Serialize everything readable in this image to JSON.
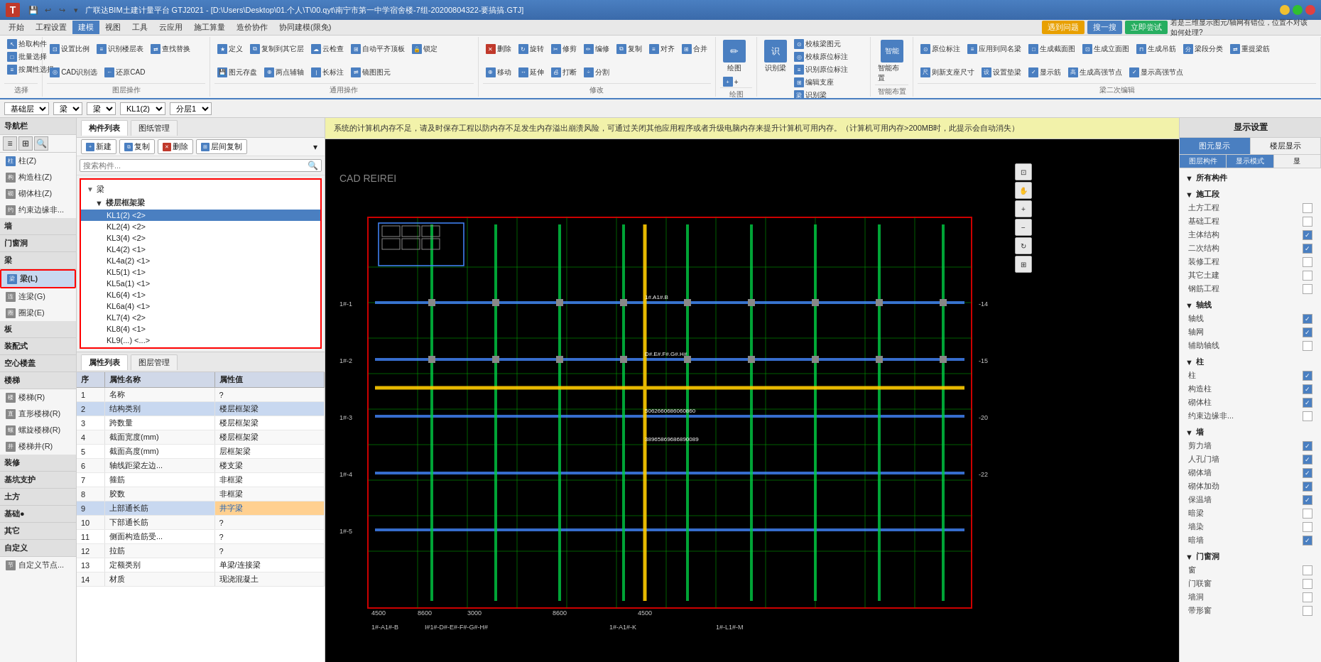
{
  "app": {
    "title": "广联达BIM土建计量平台 GTJ2021 - [D:\\Users\\Desktop\\01.个人\\T\\00.qyt\\南宁市第一中学宿舍楼-7组-20200804322-要搞搞.GTJ]",
    "icon": "T"
  },
  "menu_bar": {
    "items": [
      "开始",
      "工程设置",
      "建模",
      "视图",
      "工具",
      "云应用",
      "施工算量",
      "造价协作",
      "协同建模(限免)"
    ]
  },
  "ribbon": {
    "active_tab": "建模",
    "groups": [
      {
        "label": "选择",
        "buttons": [
          {
            "icon": "↖",
            "label": "拾取构件",
            "color": "#4a7fc1"
          },
          {
            "icon": "□",
            "label": "批量选择",
            "color": "#4a7fc1"
          },
          {
            "icon": "◎",
            "label": "按属性选择",
            "color": "#4a7fc1"
          }
        ]
      },
      {
        "label": "图层操作",
        "buttons": [
          {
            "icon": "✓",
            "label": "设置比例"
          },
          {
            "icon": "★",
            "label": "识别楼层表"
          },
          {
            "icon": "⇄",
            "label": "查找替换"
          },
          {
            "icon": "◎",
            "label": "CAD识别选"
          },
          {
            "icon": "←",
            "label": "还原CAD"
          }
        ]
      },
      {
        "label": "通用操作",
        "buttons": []
      },
      {
        "label": "修改",
        "buttons": []
      },
      {
        "label": "绘图",
        "buttons": []
      },
      {
        "label": "识梁",
        "buttons": []
      },
      {
        "label": "智能布置",
        "buttons": []
      },
      {
        "label": "梁二次编辑",
        "buttons": []
      }
    ]
  },
  "layer_bar": {
    "items": [
      "基础层",
      "梁",
      "梁",
      "KL1(2)",
      "分层1"
    ]
  },
  "nav": {
    "title": "导航栏",
    "sections": [
      {
        "label": "",
        "items": [
          {
            "label": "柱(Z)",
            "icon": "柱",
            "selected": false
          },
          {
            "label": "构造柱(Z)",
            "icon": "构",
            "selected": false
          },
          {
            "label": "砌体柱(Z)",
            "icon": "砌",
            "selected": false
          },
          {
            "label": "约束边缘非...",
            "icon": "约",
            "selected": false
          }
        ]
      },
      {
        "label": "墙",
        "items": []
      },
      {
        "label": "门窗洞",
        "items": []
      },
      {
        "label": "梁",
        "items": [
          {
            "label": "梁(L)",
            "icon": "梁",
            "selected": true
          },
          {
            "label": "连梁(G)",
            "icon": "连",
            "selected": false
          },
          {
            "label": "圈梁(E)",
            "icon": "圈",
            "selected": false
          }
        ]
      },
      {
        "label": "板",
        "items": []
      },
      {
        "label": "装配式",
        "items": []
      },
      {
        "label": "空心楼盖",
        "items": []
      },
      {
        "label": "楼梯",
        "items": [
          {
            "label": "楼梯(R)",
            "icon": "楼",
            "selected": false
          },
          {
            "label": "直形楼梯(R)",
            "icon": "直",
            "selected": false
          },
          {
            "label": "螺旋楼梯(R)",
            "icon": "螺",
            "selected": false
          },
          {
            "label": "楼梯井(R)",
            "icon": "井",
            "selected": false
          }
        ]
      },
      {
        "label": "装修",
        "items": []
      },
      {
        "label": "基坑支护",
        "items": []
      },
      {
        "label": "土方",
        "items": []
      },
      {
        "label": "基础",
        "items": []
      },
      {
        "label": "其它",
        "items": []
      },
      {
        "label": "自定义",
        "items": [
          {
            "label": "自定义节点...",
            "icon": "节",
            "selected": false
          }
        ]
      }
    ]
  },
  "component_panel": {
    "tabs": [
      "构件列表",
      "图纸管理"
    ],
    "active_tab": "构件列表",
    "toolbar": {
      "buttons": [
        "新建",
        "复制",
        "删除",
        "层间复制"
      ]
    },
    "search_placeholder": "搜索构件...",
    "tree": {
      "root": "梁",
      "groups": [
        {
          "label": "楼层框架梁",
          "items": [
            {
              "label": "KL1(2) <2>",
              "selected": true
            },
            {
              "label": "KL2(4) <2>"
            },
            {
              "label": "KL3(4) <2>"
            },
            {
              "label": "KL4(2) <1>"
            },
            {
              "label": "KL4a(2) <1>"
            },
            {
              "label": "KL5(1) <1>"
            },
            {
              "label": "KL5a(1) <1>"
            },
            {
              "label": "KL6(4) <1>"
            },
            {
              "label": "KL6a(4) <1>"
            },
            {
              "label": "KL7(4) <2>"
            },
            {
              "label": "KL8(4) <1>"
            },
            {
              "label": "KL9(...) <...>"
            }
          ]
        }
      ]
    }
  },
  "property_panel": {
    "tabs": [
      "属性列表",
      "图层管理"
    ],
    "active_tab": "属性列表",
    "headers": [
      "序",
      "属性名称",
      "属性值"
    ],
    "rows": [
      {
        "num": "1",
        "name": "名称",
        "value": "?",
        "highlight": false
      },
      {
        "num": "2",
        "name": "结构类别",
        "value": "楼层框架梁",
        "highlight": true
      },
      {
        "num": "3",
        "name": "跨数量",
        "value": "楼层框架梁",
        "highlight": false
      },
      {
        "num": "4",
        "name": "截面宽度(mm)",
        "value": "楼层框架梁",
        "highlight": false
      },
      {
        "num": "5",
        "name": "截面高度(mm)",
        "value": "层框架梁",
        "highlight": false
      },
      {
        "num": "6",
        "name": "轴线距梁左边...",
        "value": "楼支梁",
        "highlight": false
      },
      {
        "num": "7",
        "name": "箍筋",
        "value": "非框梁",
        "highlight": false
      },
      {
        "num": "8",
        "name": "胶数",
        "value": "非框梁",
        "highlight": false
      },
      {
        "num": "9",
        "name": "上部通长筋",
        "value": "井字梁",
        "highlight": true,
        "value_color": "blue"
      },
      {
        "num": "10",
        "name": "下部通长筋",
        "value": "?",
        "highlight": false
      },
      {
        "num": "11",
        "name": "侧面构造筋受...",
        "value": "?",
        "highlight": false
      },
      {
        "num": "12",
        "name": "拉筋",
        "value": "?",
        "highlight": false
      },
      {
        "num": "13",
        "name": "定额类别",
        "value": "单梁/连接梁",
        "highlight": false
      },
      {
        "num": "14",
        "name": "材质",
        "value": "现浇混凝土",
        "highlight": false
      }
    ]
  },
  "display_settings": {
    "title": "显示设置",
    "tabs": [
      "图元显示",
      "楼层显示"
    ],
    "active_tab": "图元显示",
    "sub_tabs": [
      "图层构件",
      "显示模式",
      "显"
    ],
    "active_sub_tab": "显示模式",
    "sections": [
      {
        "label": "所有构件",
        "items": []
      },
      {
        "label": "施工段",
        "items": [
          {
            "label": "土方工程",
            "checked": false
          },
          {
            "label": "基础工程",
            "checked": false
          },
          {
            "label": "主体结构",
            "checked": true
          },
          {
            "label": "二次结构",
            "checked": true
          },
          {
            "label": "装修工程",
            "checked": false
          },
          {
            "label": "其它土建",
            "checked": false
          },
          {
            "label": "钢筋工程",
            "checked": false
          }
        ]
      },
      {
        "label": "轴线",
        "items": [
          {
            "label": "轴线",
            "checked": true
          },
          {
            "label": "轴网",
            "checked": true
          },
          {
            "label": "辅助轴线",
            "checked": false
          }
        ]
      },
      {
        "label": "柱",
        "items": [
          {
            "label": "柱",
            "checked": true
          },
          {
            "label": "构造柱",
            "checked": true
          },
          {
            "label": "砌体柱",
            "checked": true
          },
          {
            "label": "约束边缘非...",
            "checked": false
          }
        ]
      },
      {
        "label": "墙",
        "items": [
          {
            "label": "剪力墙",
            "checked": true
          },
          {
            "label": "人孔门墙",
            "checked": true
          },
          {
            "label": "砌体墙",
            "checked": true
          },
          {
            "label": "砌体加劲",
            "checked": true
          },
          {
            "label": "保温墙",
            "checked": true
          },
          {
            "label": "暗梁",
            "checked": false
          },
          {
            "label": "墙染",
            "checked": false
          },
          {
            "label": "暗墙",
            "checked": true
          }
        ]
      },
      {
        "label": "门窗洞",
        "items": [
          {
            "label": "窗",
            "checked": false
          },
          {
            "label": "门联窗",
            "checked": false
          },
          {
            "label": "墙洞",
            "checked": false
          },
          {
            "label": "带形窗",
            "checked": false
          }
        ]
      }
    ]
  },
  "canvas": {
    "warning": "系统的计算机内存不足，请及时保存工程以防内存不足发生内存溢出崩溃风险，可通过关闭其他应用程序或者升级电脑内存来提升计算机可用内存。（计算机可用内存>200MB时，此提示会自动消失）",
    "cad_label": "CAD REIREI"
  },
  "top_right_help": {
    "text": "若是三维显示图元/轴网有错位，位置不对该如何处理?"
  },
  "action_buttons": {
    "goto": "遇到问题",
    "search1": "搜一搜",
    "try_immediately": "立即尝试"
  }
}
